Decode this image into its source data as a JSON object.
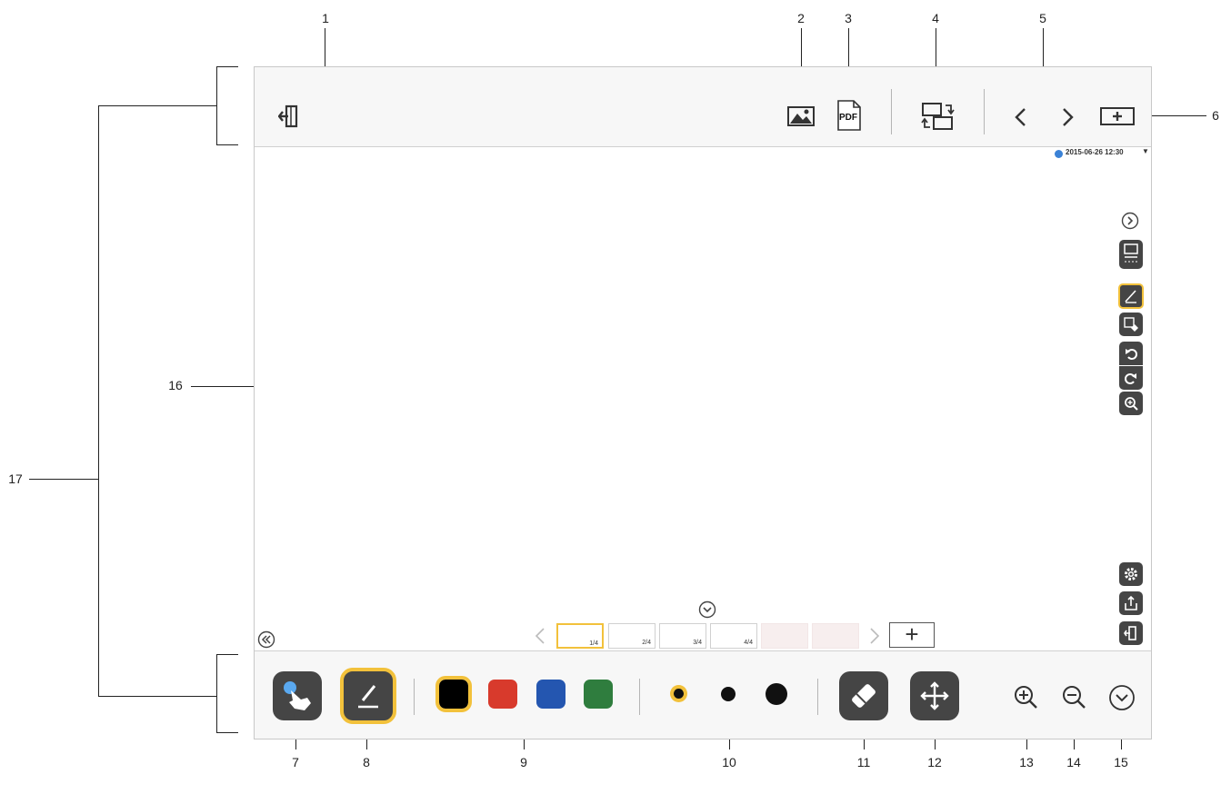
{
  "callouts": [
    "1",
    "2",
    "3",
    "4",
    "5",
    "6",
    "7",
    "8",
    "9",
    "10",
    "11",
    "12",
    "13",
    "14",
    "15",
    "16",
    "17"
  ],
  "screen": {
    "datetime": "2015-06-26 12:30",
    "dropdown_glyph": "▼",
    "pages": [
      "1/4",
      "2/4",
      "3/4",
      "4/4"
    ],
    "add_page_label": "+",
    "pdf_label": "PDF"
  },
  "colors": {
    "accent": "#f2c13b",
    "button_dark": "#454545",
    "swatch_black": "#000000",
    "swatch_red": "#d83a2c",
    "swatch_blue": "#2456b0",
    "swatch_green": "#2f7d3e",
    "info_blue": "#3b82d6"
  },
  "icons": [
    "exit-icon",
    "image-icon",
    "pdf-icon",
    "switch-screen-icon",
    "prev-icon",
    "next-icon",
    "add-page-icon",
    "hand-icon",
    "pen-icon",
    "eraser-icon",
    "move-icon",
    "zoom-in-icon",
    "zoom-out-icon",
    "collapse-icon"
  ]
}
